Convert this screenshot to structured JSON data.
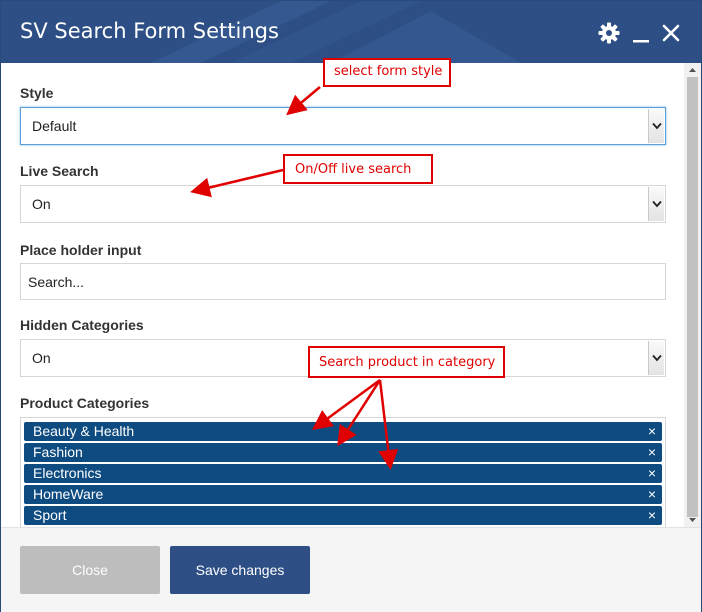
{
  "dialog": {
    "title": "SV Search Form Settings"
  },
  "icons": {
    "settings": "gear-icon",
    "minimize": "minimize-icon",
    "close": "close-icon"
  },
  "fields": {
    "style": {
      "label": "Style",
      "value": "Default"
    },
    "live_search": {
      "label": "Live Search",
      "value": "On"
    },
    "placeholder": {
      "label": "Place holder input",
      "value": "Search..."
    },
    "hidden_categories": {
      "label": "Hidden Categories",
      "value": "On"
    },
    "product_categories": {
      "label": "Product Categories",
      "tags": [
        "Beauty & Health",
        "Fashion",
        "Electronics",
        "HomeWare",
        "Sport"
      ],
      "remove_glyph": "×"
    }
  },
  "footer": {
    "close_label": "Close",
    "save_label": "Save changes"
  },
  "annotations": {
    "style_note": "select form style",
    "live_note": "On/Off live search",
    "category_note": "Search product in category"
  },
  "colors": {
    "header": "#2d4f86",
    "tag": "#0e4b80",
    "annotation": "#e00000"
  }
}
